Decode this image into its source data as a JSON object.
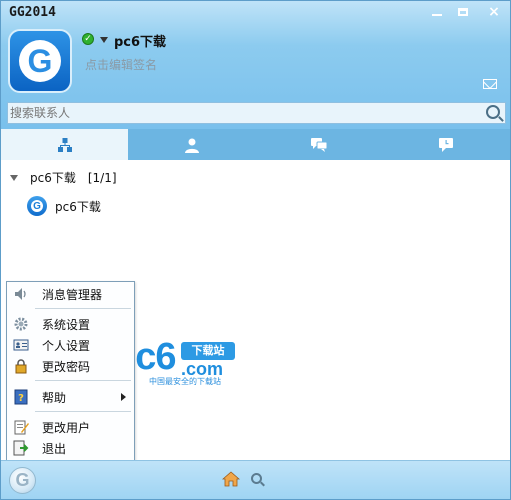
{
  "window": {
    "title": "GG2014",
    "minimize": "minimize",
    "maximize": "maximize",
    "close": "×"
  },
  "profile": {
    "avatar_letter": "G",
    "status": "online",
    "nickname": "pc6下载",
    "signature": "点击编辑签名"
  },
  "search": {
    "placeholder": "搜索联系人"
  },
  "tabs": [
    {
      "name": "contacts-tab",
      "icon": "org-tree-icon"
    },
    {
      "name": "friends-tab",
      "icon": "person-icon"
    },
    {
      "name": "groups-tab",
      "icon": "chat-bubbles-icon"
    },
    {
      "name": "recent-tab",
      "icon": "recent-chat-icon"
    }
  ],
  "group": {
    "name": "pc6下载",
    "count": "[1/1]"
  },
  "contact": {
    "name": "pc6下载",
    "avatar_letter": "G"
  },
  "menu": {
    "items": [
      {
        "label": "消息管理器",
        "icon": "speaker-icon"
      },
      {
        "label": "系统设置",
        "icon": "gear-icon"
      },
      {
        "label": "个人设置",
        "icon": "id-card-icon"
      },
      {
        "label": "更改密码",
        "icon": "lock-icon"
      },
      {
        "label": "帮助",
        "icon": "help-book-icon"
      },
      {
        "label": "更改用户",
        "icon": "edit-user-icon"
      },
      {
        "label": "退出",
        "icon": "exit-icon"
      }
    ]
  },
  "watermark": {
    "brand": "pc6",
    "badge": "下载站",
    "domain": ".com",
    "tagline": "中国最安全的下载站"
  },
  "bottom_bar": {
    "main_letter": "G"
  },
  "colors": {
    "header_top": "#bfe3f8",
    "header_bottom": "#79c0ec",
    "tab_bar": "#6cb5e2",
    "active_tab": "#eaf5fb",
    "brand_blue": "#1f8ede",
    "status_online": "#2fb12f"
  }
}
